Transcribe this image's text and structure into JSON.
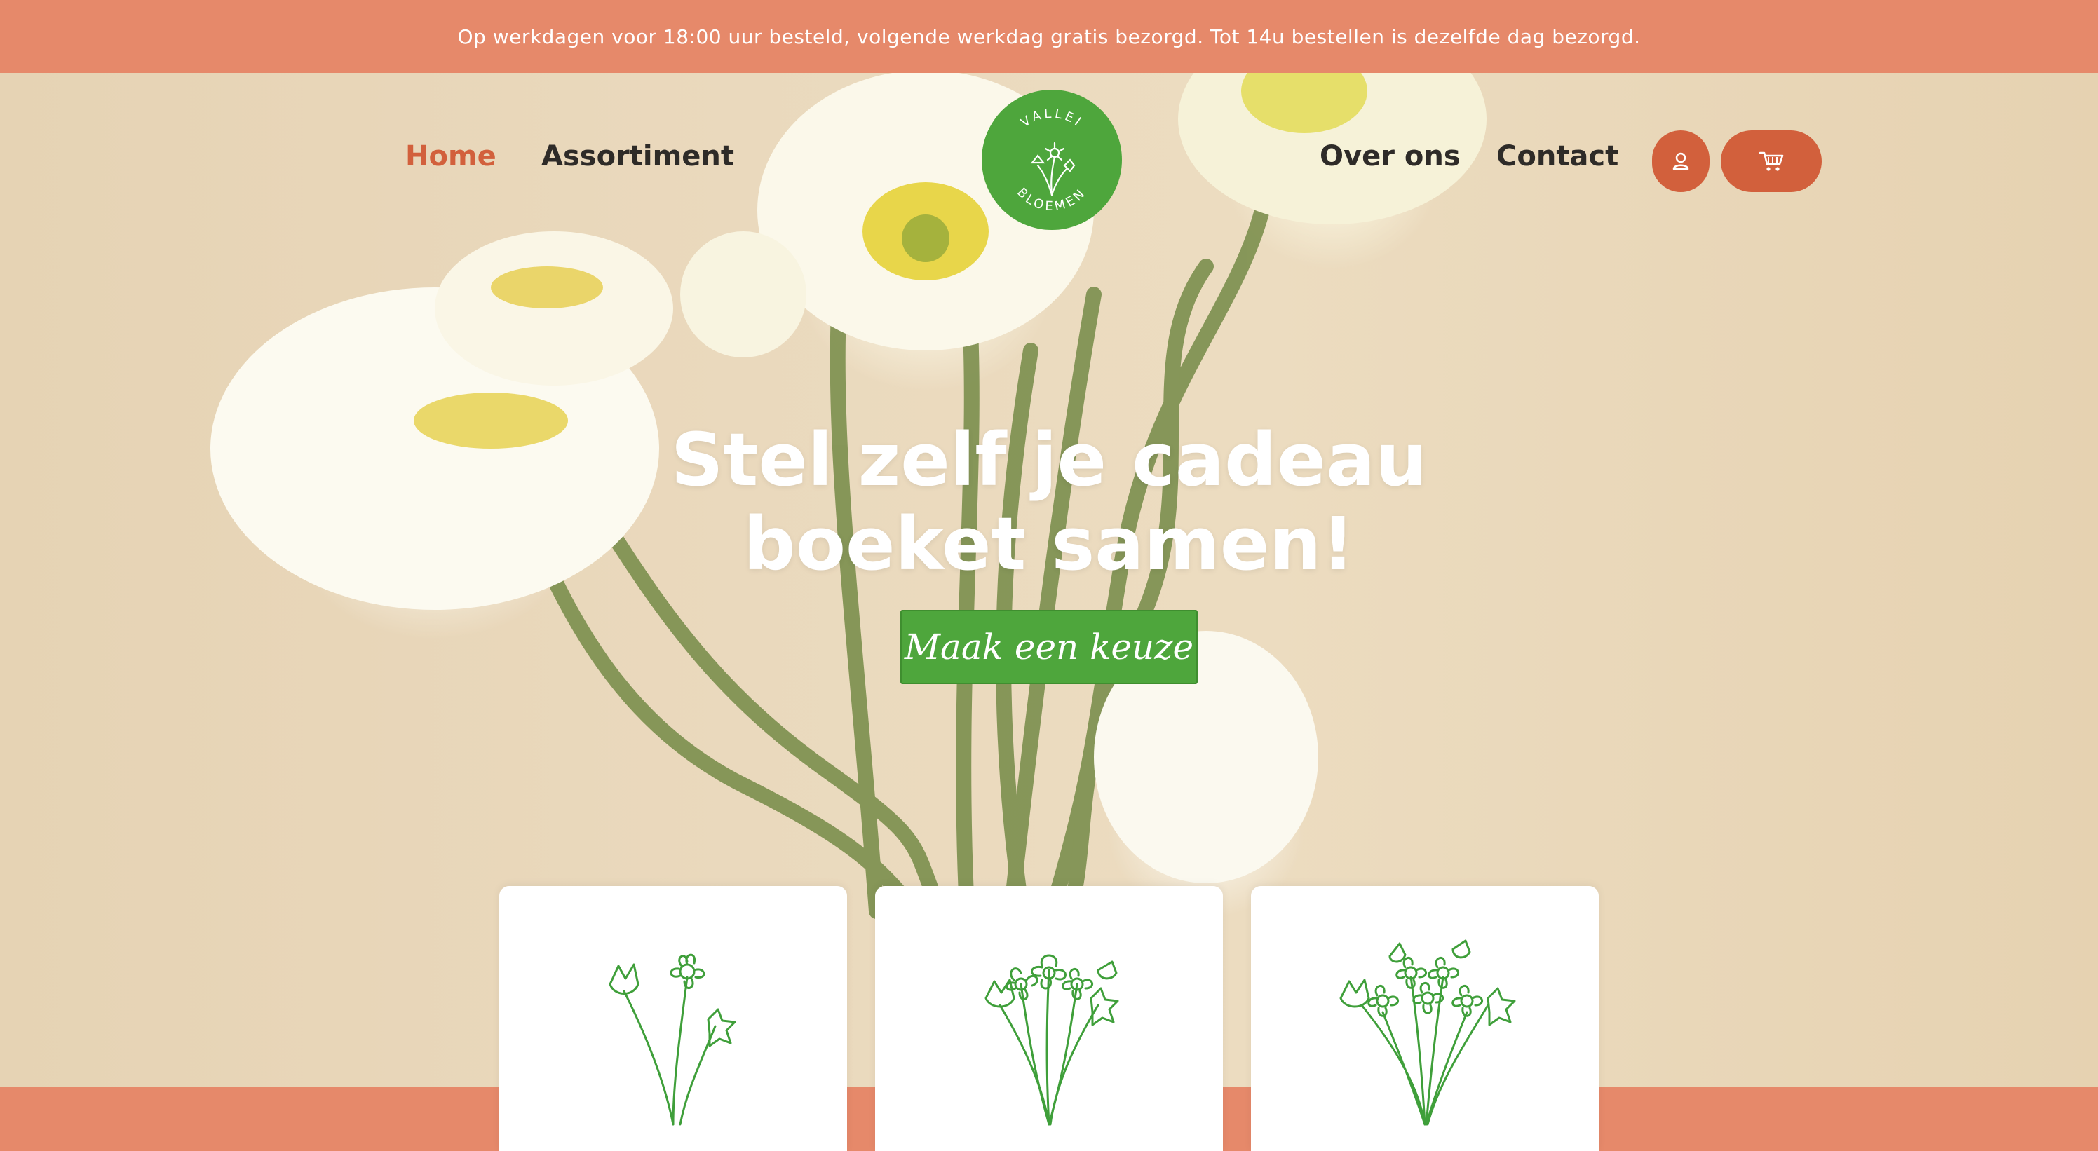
{
  "colors": {
    "accent": "#e6896a",
    "brand_green": "#4ea63c",
    "nav_active": "#d2603c",
    "button_orange": "#d2603c"
  },
  "announcement": "Op werkdagen voor 18:00 uur besteld, volgende werkdag gratis bezorgd. Tot 14u bestellen is dezelfde dag bezorgd.",
  "nav": {
    "home": "Home",
    "assortment": "Assortiment",
    "about": "Over ons",
    "contact": "Contact"
  },
  "logo": {
    "top_text": "VALLEI",
    "bottom_text": "BLOEMEN"
  },
  "icons": {
    "account": "user-icon",
    "cart": "cart-icon"
  },
  "hero": {
    "headline_line1": "Stel zelf je cadeau",
    "headline_line2": "boeket samen!",
    "cta": "Maak een keuze"
  },
  "cards": [
    {
      "icon": "small-bouquet-icon"
    },
    {
      "icon": "medium-bouquet-icon"
    },
    {
      "icon": "large-bouquet-icon"
    }
  ]
}
